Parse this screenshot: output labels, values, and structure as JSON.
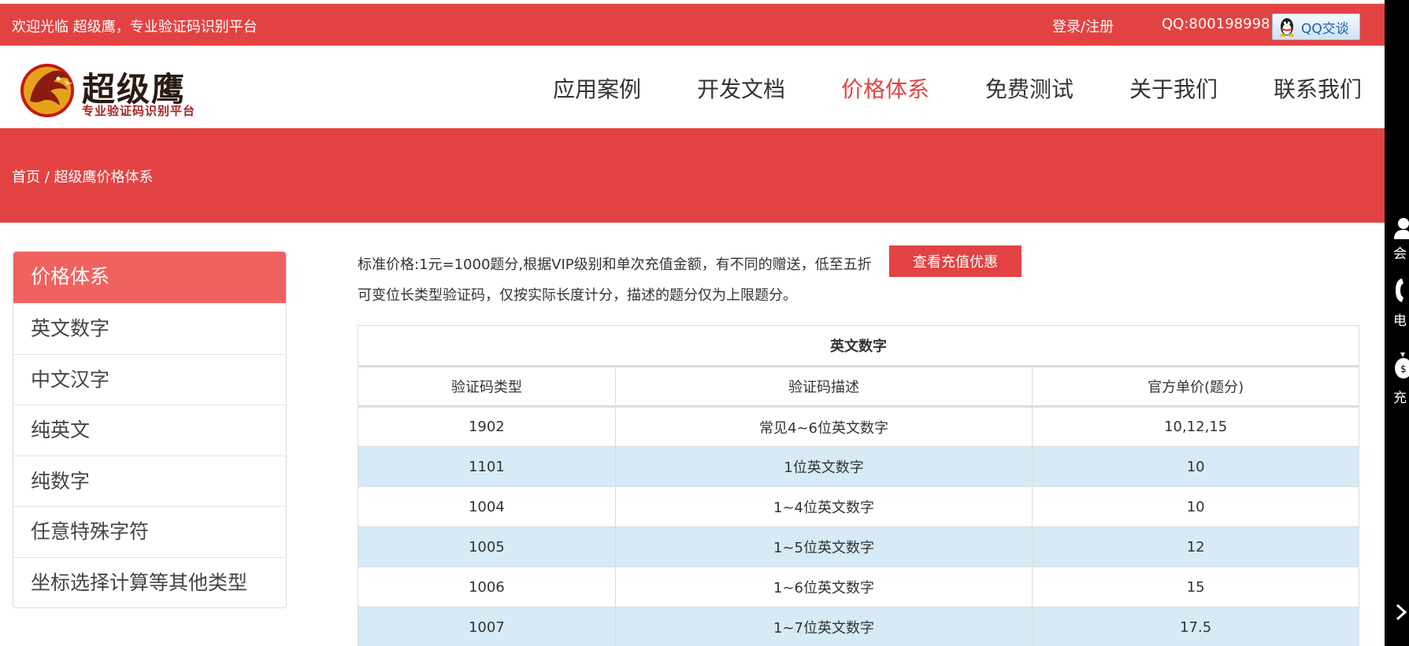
{
  "topbar": {
    "welcome": "欢迎光临 超级鹰，专业验证码识别平台",
    "login": "登录/注册",
    "qq_number": "QQ:800198998",
    "qq_chat_label": "QQ交谈"
  },
  "logo": {
    "brand": "超级鹰",
    "slogan": "专业验证码识别平台"
  },
  "nav": {
    "items": [
      {
        "label": "应用案例"
      },
      {
        "label": "开发文档"
      },
      {
        "label": "价格体系",
        "active": true
      },
      {
        "label": "免费测试"
      },
      {
        "label": "关于我们"
      },
      {
        "label": "联系我们"
      }
    ]
  },
  "breadcrumb": "首页 / 超级鹰价格体系",
  "sidebar": {
    "header": "价格体系",
    "items": [
      "英文数字",
      "中文汉字",
      "纯英文",
      "纯数字",
      "任意特殊字符",
      "坐标选择计算等其他类型"
    ]
  },
  "content": {
    "intro_line1": "标准价格:1元=1000题分,根据VIP级别和单次充值金额，有不同的赠送，低至五折",
    "intro_line2": "可变位长类型验证码，仅按实际长度计分，描述的题分仅为上限题分。",
    "promo_button": "查看充值优惠"
  },
  "table": {
    "title": "英文数字",
    "headers": [
      "验证码类型",
      "验证码描述",
      "官方单价(题分)"
    ],
    "rows": [
      [
        "1902",
        "常见4~6位英文数字",
        "10,12,15"
      ],
      [
        "1101",
        "1位英文数字",
        "10"
      ],
      [
        "1004",
        "1~4位英文数字",
        "10"
      ],
      [
        "1005",
        "1~5位英文数字",
        "12"
      ],
      [
        "1006",
        "1~6位英文数字",
        "15"
      ],
      [
        "1007",
        "1~7位英文数字",
        "17.5"
      ]
    ]
  },
  "dock": {
    "items": [
      {
        "label": "会",
        "icon": "user-icon"
      },
      {
        "label": "电",
        "icon": "phone-icon"
      },
      {
        "label": "充",
        "icon": "money-bag-icon"
      }
    ],
    "collapse_icon": "chevron-right-icon"
  },
  "colors": {
    "brand_red": "#e24342",
    "sidebar_header": "#f06260",
    "table_alt_row": "#d6ebf5",
    "qq_link": "#1a5fb4"
  }
}
